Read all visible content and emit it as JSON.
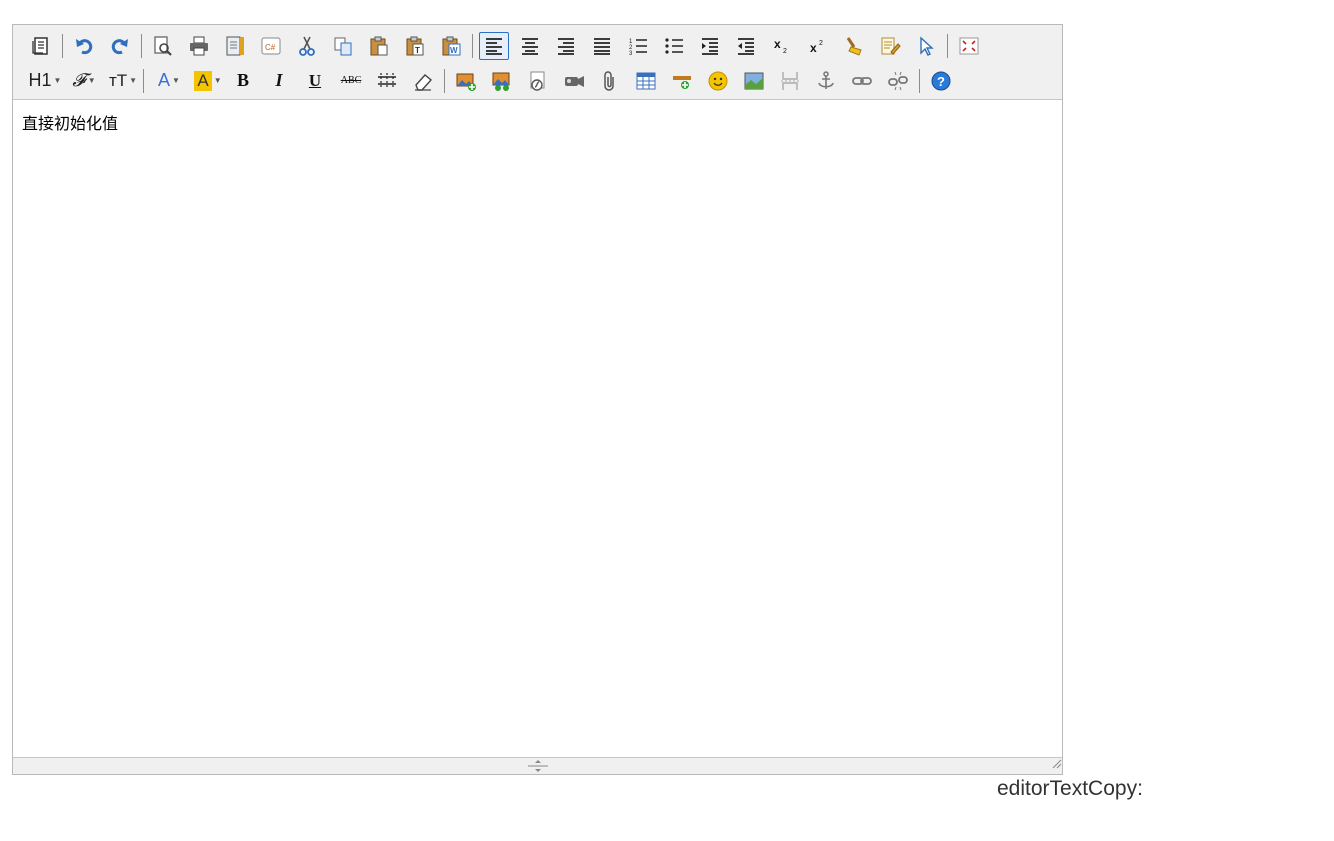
{
  "editor": {
    "content": "直接初始化值",
    "toolbar_row1": [
      "source",
      "undo",
      "redo",
      "preview",
      "print",
      "template",
      "insert-code",
      "cut",
      "copy",
      "paste",
      "paste-plain",
      "paste-word",
      "align-left",
      "align-center",
      "align-right",
      "align-justify",
      "ordered-list",
      "unordered-list",
      "indent",
      "outdent",
      "subscript",
      "superscript",
      "clear-format",
      "format-painter",
      "select-all",
      "fullscreen"
    ],
    "toolbar_row2": [
      "heading",
      "font-family",
      "font-size",
      "font-color",
      "highlight-color",
      "bold",
      "italic",
      "underline",
      "strikethrough",
      "line-height",
      "remove-format",
      "insert-image",
      "multi-image",
      "flash",
      "media",
      "attachment",
      "table",
      "horizontal-rule",
      "emoticon",
      "map",
      "page-break",
      "anchor",
      "link",
      "unlink",
      "help"
    ],
    "active_button": "align-left",
    "labels": {
      "heading": "H1",
      "font_family": "𝓕",
      "font_size": "тT",
      "font_color": "A",
      "highlight": "A",
      "bold": "B",
      "italic": "I",
      "underline": "U",
      "strike": "ABC"
    },
    "colors": {
      "icon": "#333333",
      "accent_blue": "#2a6fc8",
      "highlight_yellow": "#f5c400",
      "font_color_blue": "#3a6fd8",
      "fullscreen_red": "#d02020",
      "help_blue": "#2a7ad8"
    }
  },
  "below_editor": {
    "label": "editorTextCopy:"
  }
}
